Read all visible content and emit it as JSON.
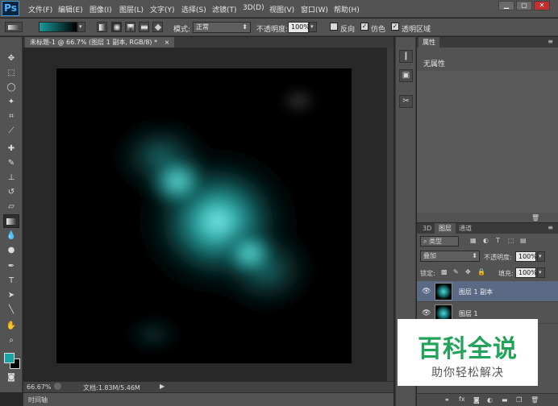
{
  "app": {
    "logo": "Ps",
    "menu": [
      "文件(F)",
      "编辑(E)",
      "图像(I)",
      "图层(L)",
      "文字(Y)",
      "选择(S)",
      "滤镜(T)",
      "3D(D)",
      "视图(V)",
      "窗口(W)",
      "帮助(H)"
    ],
    "window_controls": [
      "▁",
      "▢",
      "✕"
    ]
  },
  "options": {
    "mode_label": "模式:",
    "mode_value": "正常",
    "opacity_label": "不透明度:",
    "opacity_value": "100%",
    "reverse_label": "反向",
    "dither_label": "仿色",
    "transparency_label": "透明区域",
    "gradient_colors": [
      "#1a9a9a",
      "#000000"
    ]
  },
  "document": {
    "tab_title": "未标题-1 @ 66.7% (图层 1 副本, RGB/8) *",
    "tab_close": "×",
    "zoom": "66.67%",
    "doc_info": "文档:1.83M/5.46M"
  },
  "timeline": {
    "label": "时间轴"
  },
  "tools": {
    "icons": [
      "move-icon",
      "marquee-icon",
      "lasso-icon",
      "magic-wand-icon",
      "crop-icon",
      "eyedropper-icon",
      "healing-brush-icon",
      "brush-icon",
      "clone-stamp-icon",
      "history-brush-icon",
      "eraser-icon",
      "gradient-icon",
      "blur-icon",
      "dodge-icon",
      "pen-icon",
      "type-icon",
      "path-selection-icon",
      "line-icon",
      "hand-icon",
      "zoom-icon"
    ],
    "foreground_color": "#19a5a5",
    "background_color": "#000000"
  },
  "properties": {
    "tab": "属性",
    "empty_text": "无属性"
  },
  "layers": {
    "tabs": [
      "3D",
      "图层",
      "通道"
    ],
    "filter_label": "类型",
    "blend_mode": "叠加",
    "opacity_label": "不透明度:",
    "opacity_value": "100%",
    "lock_label": "锁定:",
    "fill_label": "填充:",
    "fill_value": "100%",
    "items": [
      {
        "name": "图层 1 副本",
        "selected": true
      },
      {
        "name": "图层 1",
        "selected": false
      }
    ]
  },
  "watermark": {
    "title": "百科全说",
    "subtitle": "助你轻松解决"
  }
}
